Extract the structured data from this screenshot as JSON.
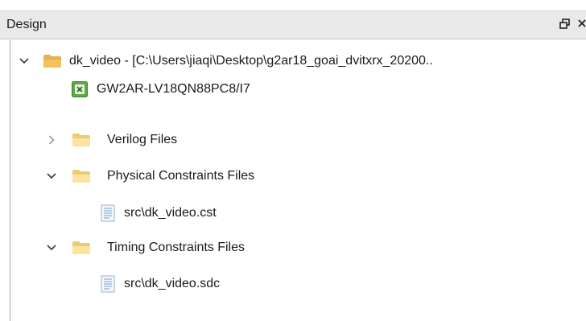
{
  "panel": {
    "title": "Design",
    "float_glyph": "🗗",
    "close_glyph": "×"
  },
  "tree": {
    "project": {
      "label": "dk_video - [C:\\Users\\jiaqi\\Desktop\\g2ar18_goai_dvitxrx_20200..",
      "expanded": true,
      "icon": "project-folder-icon"
    },
    "device": {
      "label": "GW2AR-LV18QN88PC8/I7",
      "icon": "chip-icon"
    },
    "verilog": {
      "label": "Verilog Files",
      "expanded": false,
      "icon": "folder-icon"
    },
    "physical": {
      "label": "Physical Constraints Files",
      "expanded": true,
      "icon": "folder-icon"
    },
    "cst_file": {
      "label": "src\\dk_video.cst",
      "icon": "file-icon"
    },
    "timing": {
      "label": "Timing Constraints Files",
      "expanded": true,
      "icon": "folder-icon"
    },
    "sdc_file": {
      "label": "src\\dk_video.sdc",
      "icon": "file-icon"
    }
  },
  "colors": {
    "header_bg": "#e9e9e9",
    "folder": "#f5d27a",
    "folder_dark": "#e3b24a",
    "chip_green": "#4f9a3a"
  }
}
